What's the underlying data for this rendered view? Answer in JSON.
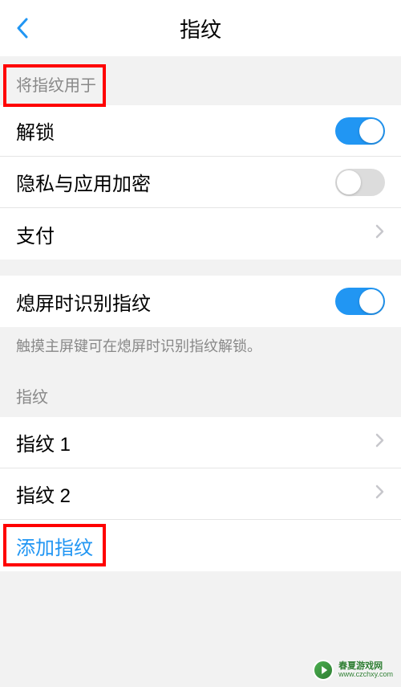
{
  "header": {
    "title": "指纹"
  },
  "section1": {
    "header": "将指纹用于",
    "unlock_label": "解锁",
    "unlock_on": true,
    "privacy_label": "隐私与应用加密",
    "privacy_on": false,
    "pay_label": "支付"
  },
  "section2": {
    "screenoff_label": "熄屏时识别指纹",
    "screenoff_on": true,
    "hint": "触摸主屏键可在熄屏时识别指纹解锁。"
  },
  "section3": {
    "header": "指纹",
    "fp1_label": "指纹 1",
    "fp2_label": "指纹 2",
    "add_label": "添加指纹"
  },
  "watermark": {
    "name": "春夏游戏网",
    "url": "www.czchxy.com"
  }
}
